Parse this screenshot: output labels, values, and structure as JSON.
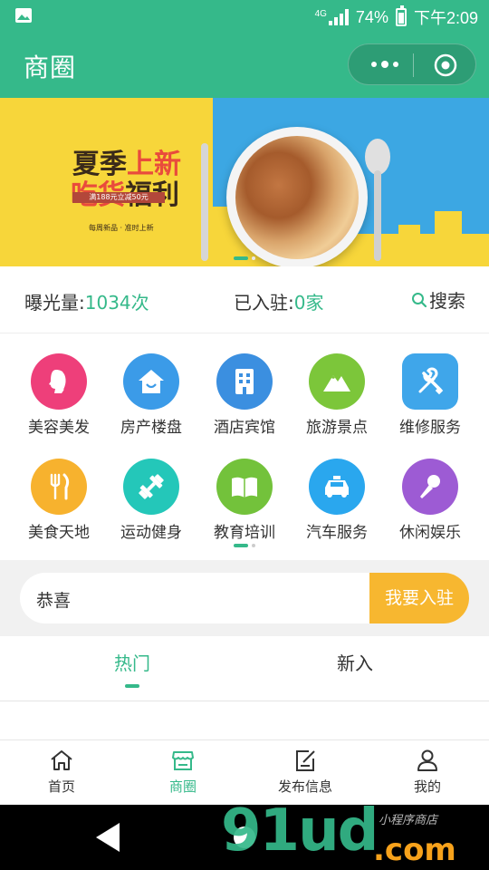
{
  "status_bar": {
    "network": "4G",
    "battery": "74%",
    "time": "下午2:09",
    "battery_level": 0.74
  },
  "header": {
    "title": "商圈"
  },
  "banner": {
    "line1_a": "夏季",
    "line1_b": "上新",
    "line2_a": "吃货",
    "line2_b": "福利",
    "promo": "满188元立减50元",
    "sub": "每周新品 · 准时上新",
    "slide_count": 2,
    "active_slide": 1
  },
  "stats": {
    "exposure_label": "曝光量:",
    "exposure_value": "1034次",
    "joined_label": "已入驻:",
    "joined_value": "0家",
    "search_label": "搜索"
  },
  "categories": [
    {
      "label": "美容美发",
      "icon": "woman-profile-icon",
      "color": "#ee3f7a"
    },
    {
      "label": "房产楼盘",
      "icon": "house-icon",
      "color": "#3b9be8"
    },
    {
      "label": "酒店宾馆",
      "icon": "building-icon",
      "color": "#3b8fe0"
    },
    {
      "label": "旅游景点",
      "icon": "mountain-icon",
      "color": "#7cc63a"
    },
    {
      "label": "维修服务",
      "icon": "tools-icon",
      "color": "#3fa6ea"
    },
    {
      "label": "美食天地",
      "icon": "fork-knife-icon",
      "color": "#f7b22e"
    },
    {
      "label": "运动健身",
      "icon": "dumbbell-icon",
      "color": "#24c7b9"
    },
    {
      "label": "教育培训",
      "icon": "book-icon",
      "color": "#73c23b"
    },
    {
      "label": "汽车服务",
      "icon": "taxi-icon",
      "color": "#2aa7ee"
    },
    {
      "label": "休闲娱乐",
      "icon": "microphone-icon",
      "color": "#9d5bd4"
    }
  ],
  "notice": {
    "text": "恭喜",
    "button": "我要入驻"
  },
  "tabs": [
    {
      "label": "热门",
      "active": true
    },
    {
      "label": "新入",
      "active": false
    }
  ],
  "tabbar": [
    {
      "label": "首页",
      "icon": "home-icon",
      "active": false
    },
    {
      "label": "商圈",
      "icon": "shop-icon",
      "active": true
    },
    {
      "label": "发布信息",
      "icon": "edit-icon",
      "active": false
    },
    {
      "label": "我的",
      "icon": "user-icon",
      "active": false
    }
  ],
  "watermark": {
    "text": "91ud",
    "suffix": ".com",
    "small": "小程序商店"
  },
  "colors": {
    "primary": "#35b98a",
    "accent": "#f7b730"
  }
}
